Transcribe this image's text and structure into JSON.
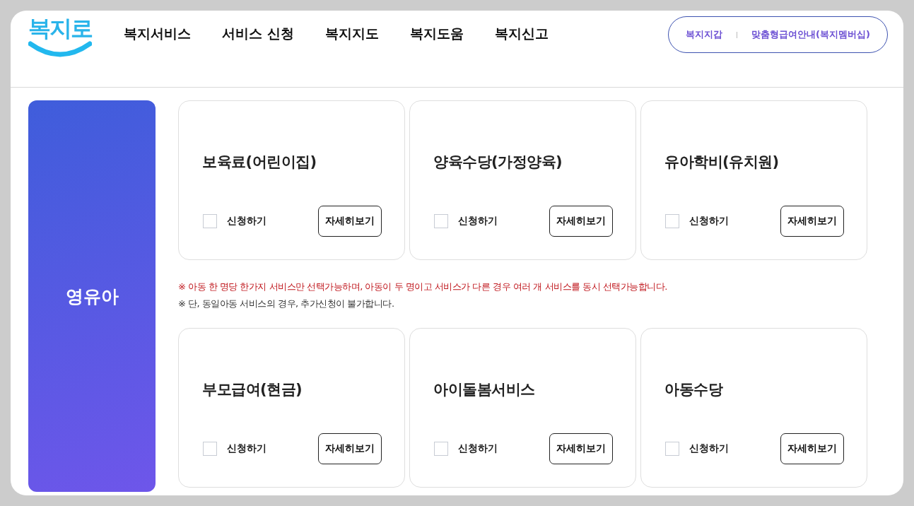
{
  "logo": "복지로",
  "nav": [
    {
      "label": "복지서비스"
    },
    {
      "label": "서비스 신청"
    },
    {
      "label": "복지지도"
    },
    {
      "label": "복지도움"
    },
    {
      "label": "복지신고"
    }
  ],
  "quick_links": [
    {
      "label": "복지지갑"
    },
    {
      "label": "맞춤형급여안내(복지멤버십)"
    }
  ],
  "category": "영유아",
  "rows": [
    {
      "services": [
        {
          "title": "보육료(어린이집)",
          "apply_label": "신청하기",
          "checked": false,
          "detail_button": "자세히보기"
        },
        {
          "title": "양육수당(가정양육)",
          "apply_label": "신청하기",
          "checked": false,
          "detail_button": "자세히보기"
        },
        {
          "title": "유아학비(유치원)",
          "apply_label": "신청하기",
          "checked": false,
          "detail_button": "자세히보기"
        }
      ],
      "notes": [
        {
          "kind": "warning",
          "text": "※ 아동 한 명당 한가지 서비스만 선택가능하며, 아동이 두 명이고 서비스가 다른 경우 여러 개 서비스를 동시 선택가능합니다."
        },
        {
          "kind": "info",
          "text": "※ 단, 동일아동 서비스의 경우, 추가신청이 불가합니다."
        }
      ]
    },
    {
      "services": [
        {
          "title": "부모급여(현금)",
          "apply_label": "신청하기",
          "checked": false,
          "detail_button": "자세히보기"
        },
        {
          "title": "아이돌봄서비스",
          "apply_label": "신청하기",
          "checked": false,
          "detail_button": "자세히보기"
        },
        {
          "title": "아동수당",
          "apply_label": "신청하기",
          "checked": false,
          "detail_button": "자세히보기"
        }
      ]
    }
  ]
}
